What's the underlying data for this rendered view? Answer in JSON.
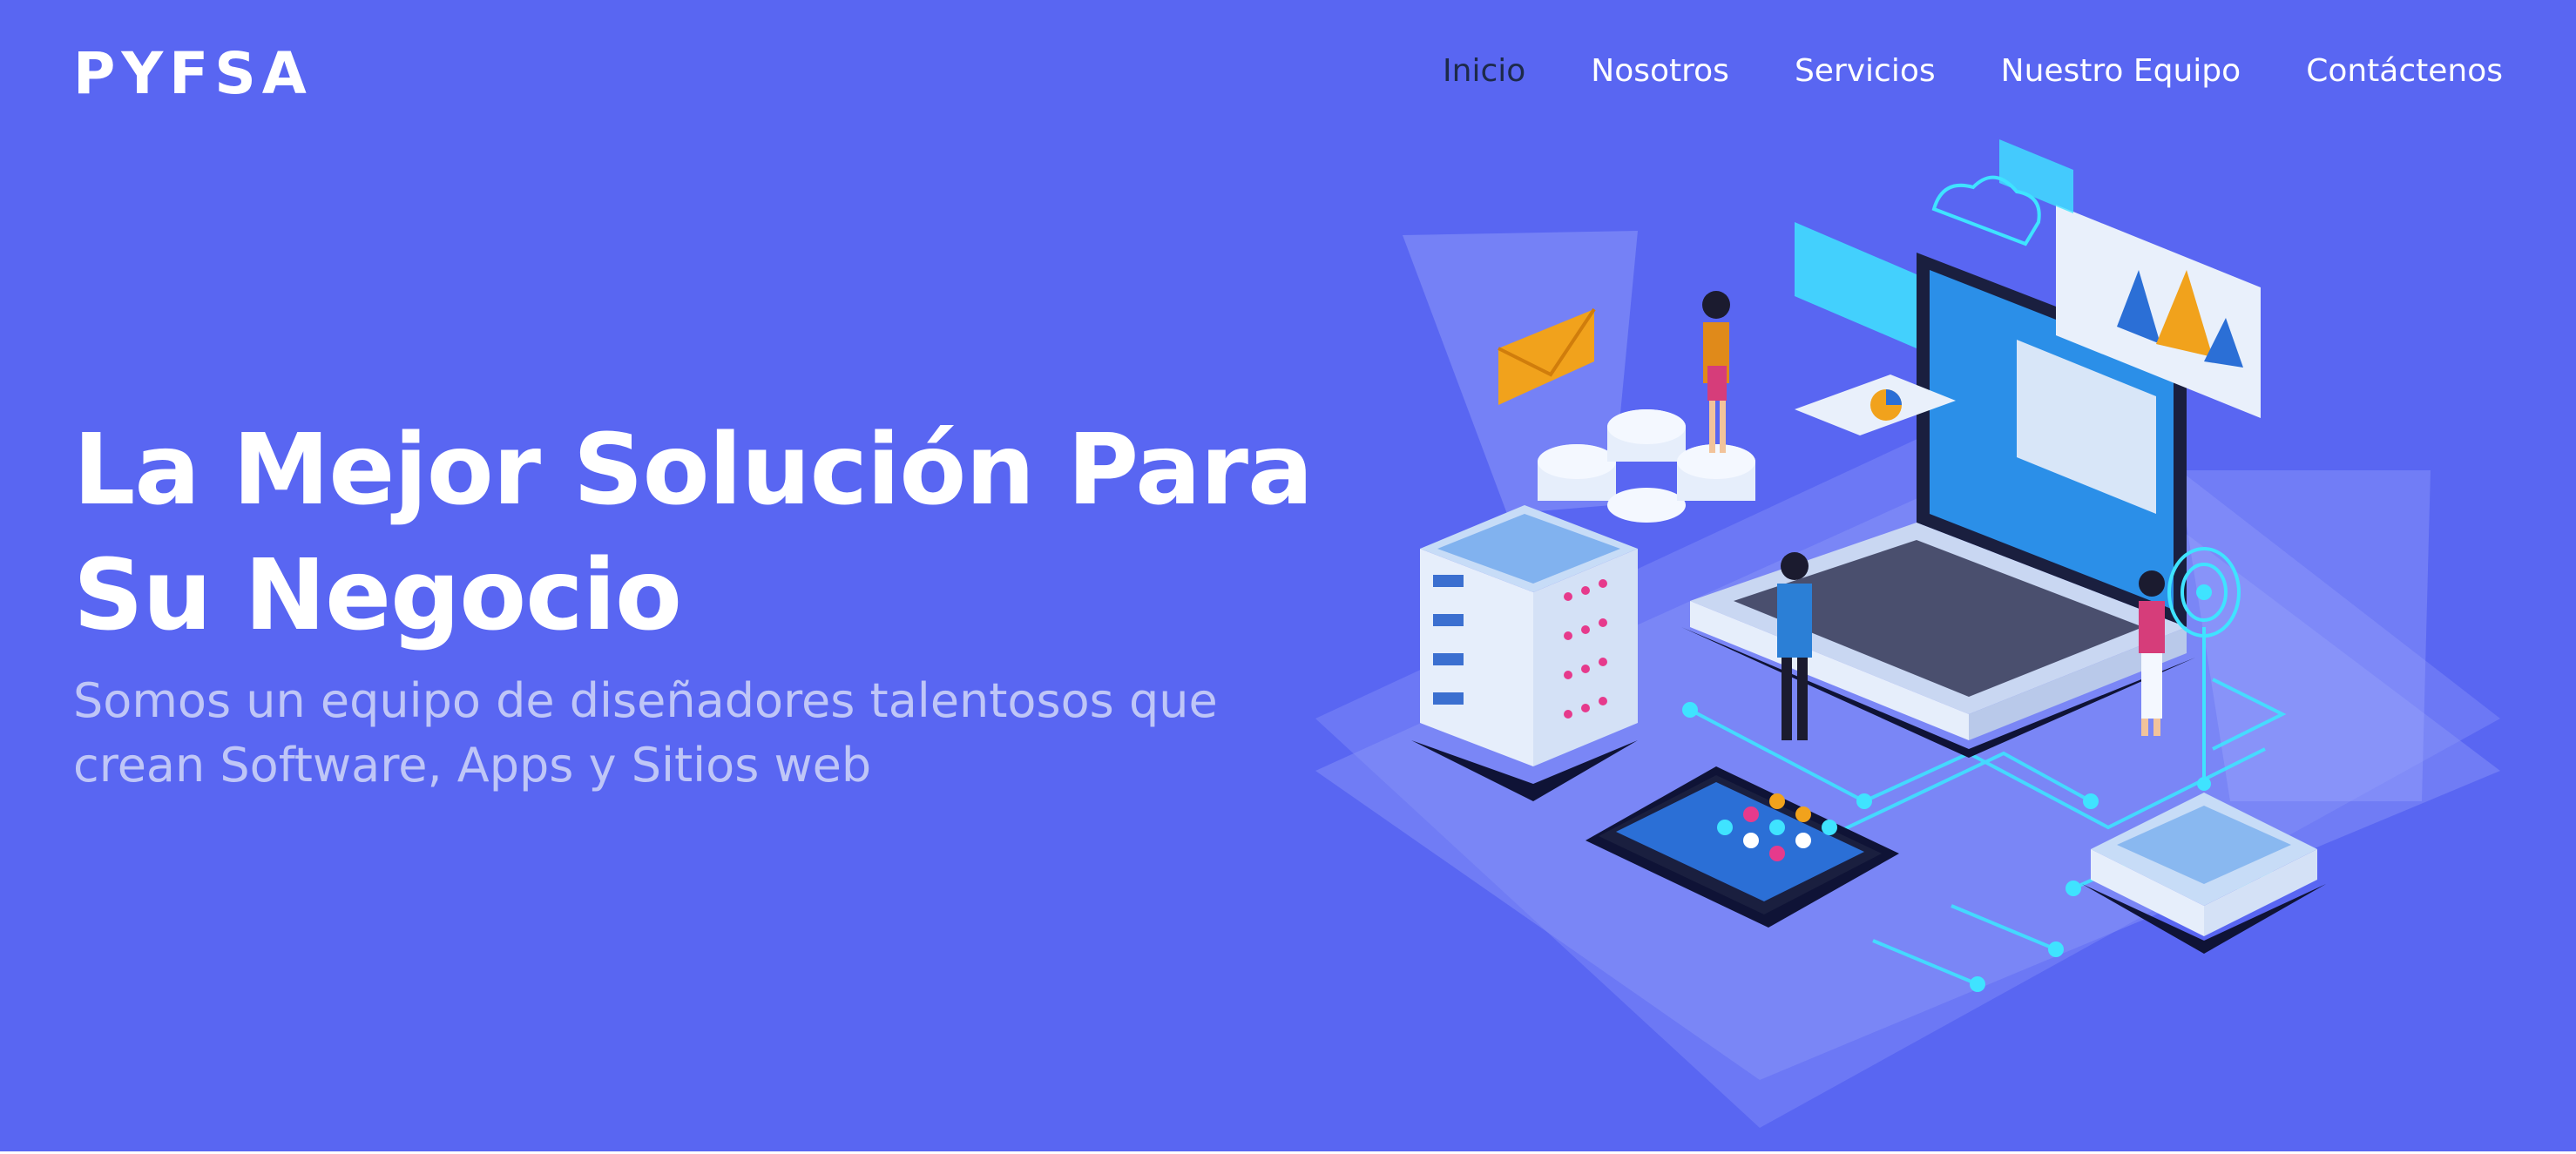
{
  "header": {
    "logo": "PYFSA",
    "nav": [
      {
        "label": "Inicio",
        "active": true
      },
      {
        "label": "Nosotros",
        "active": false
      },
      {
        "label": "Servicios",
        "active": false
      },
      {
        "label": "Nuestro Equipo",
        "active": false
      },
      {
        "label": "Contáctenos",
        "active": false
      }
    ]
  },
  "hero": {
    "headline": "La Mejor Solución Para Su Negocio",
    "subtitle": "Somos un equipo de diseñadores talentosos que crean Software, Apps y Sitios web",
    "illustration_icon": "isometric-tech-illustration"
  },
  "colors": {
    "background": "#5966f2",
    "active_nav": "#1d2a4a",
    "subtitle": "#bfc6f7",
    "accent_cyan": "#3fe3ff"
  }
}
